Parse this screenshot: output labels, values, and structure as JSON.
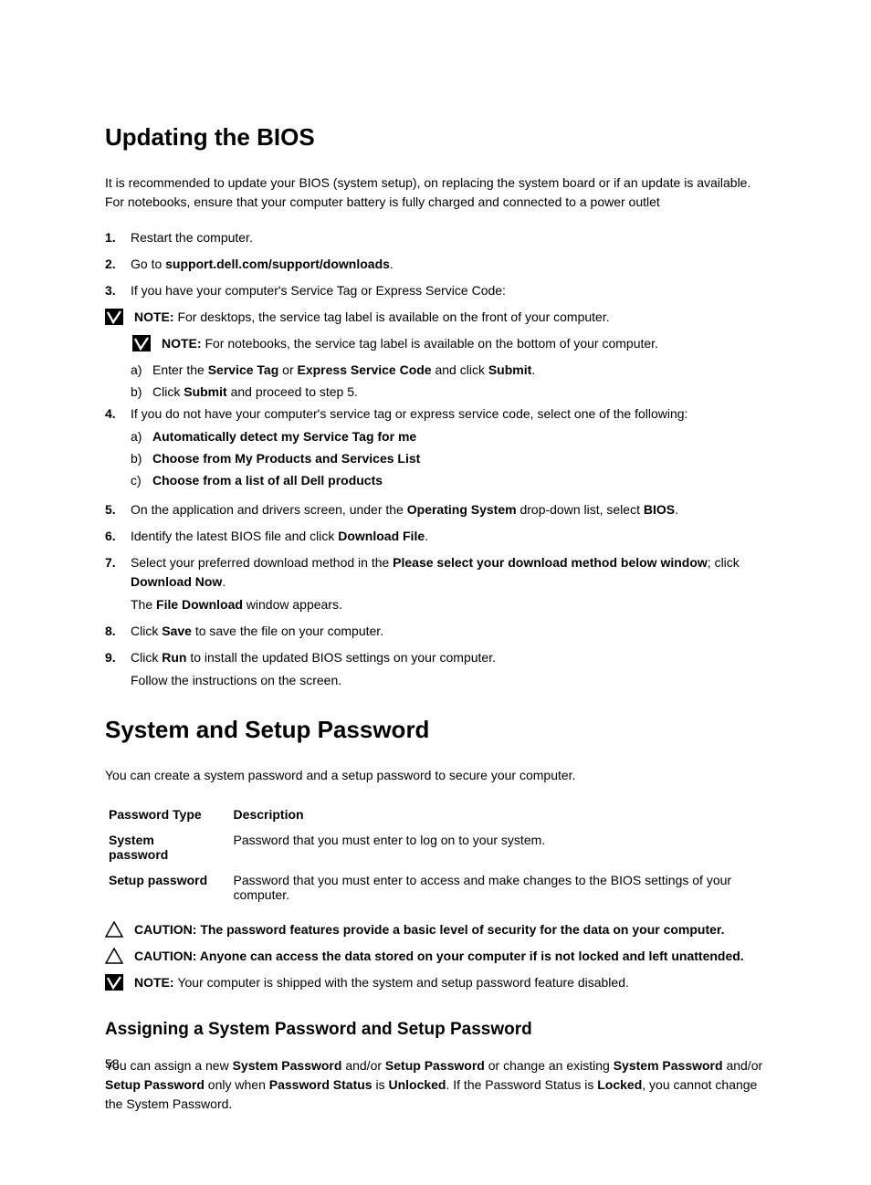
{
  "section1": {
    "title": "Updating the BIOS",
    "intro": "It is recommended to update your BIOS (system setup), on replacing the system board or if an update is available. For notebooks, ensure that your computer battery is fully charged and connected to a power outlet",
    "step1": "Restart the computer.",
    "step2_pre": "Go to ",
    "step2_bold": "support.dell.com/support/downloads",
    "step2_post": ".",
    "step3": "If you have your computer's Service Tag or Express Service Code:",
    "note1_label": "NOTE: ",
    "note1_text": "For desktops, the service tag label is available on the front of your computer.",
    "note2_label": "NOTE: ",
    "note2_text": "For notebooks, the service tag label is available on the bottom of your computer.",
    "step3a_pre": "Enter the ",
    "step3a_b1": "Service Tag",
    "step3a_mid": " or ",
    "step3a_b2": "Express Service Code",
    "step3a_mid2": " and click ",
    "step3a_b3": "Submit",
    "step3a_post": ".",
    "step3b_pre": "Click ",
    "step3b_b1": "Submit",
    "step3b_post": " and proceed to step 5.",
    "step4": "If you do not have your computer's service tag or express service code, select one of the following:",
    "step4a": "Automatically detect my Service Tag for me",
    "step4b": "Choose from My Products and Services List",
    "step4c": "Choose from a list of all Dell products",
    "step5_pre": "On the application and drivers screen, under the ",
    "step5_b1": "Operating System",
    "step5_mid": " drop-down list, select ",
    "step5_b2": "BIOS",
    "step5_post": ".",
    "step6_pre": "Identify the latest BIOS file and click ",
    "step6_b1": "Download File",
    "step6_post": ".",
    "step7_pre": "Select your preferred download method in the ",
    "step7_b1": "Please select your download method below window",
    "step7_mid": "; click ",
    "step7_b2": "Download Now",
    "step7_post": ".",
    "step7_after_pre": "The ",
    "step7_after_b": "File Download",
    "step7_after_post": " window appears.",
    "step8_pre": "Click ",
    "step8_b1": "Save",
    "step8_post": " to save the file on your computer.",
    "step9_pre": "Click ",
    "step9_b1": "Run",
    "step9_post": " to install the updated BIOS settings on your computer.",
    "step9_after": "Follow the instructions on the screen."
  },
  "section2": {
    "title": "System and Setup Password",
    "intro": "You can create a system password and a setup password to secure your computer.",
    "th1": "Password Type",
    "th2": "Description",
    "row1_c1": "System password",
    "row1_c2": "Password that you must enter to log on to your system.",
    "row2_c1": "Setup password",
    "row2_c2": "Password that you must enter to access and make changes to the BIOS settings of your computer.",
    "caution1": "CAUTION: The password features provide a basic level of security for the data on your computer.",
    "caution2": "CAUTION: Anyone can access the data stored on your computer if is not locked and left unattended.",
    "note_label": "NOTE: ",
    "note_text": "Your computer is shipped with the system and setup password feature disabled.",
    "sub_title": "Assigning a System Password and Setup Password",
    "sub_p_1": "You can assign a new ",
    "sub_p_b1": "System Password",
    "sub_p_2": " and/or ",
    "sub_p_b2": "Setup Password",
    "sub_p_3": " or change an existing ",
    "sub_p_b3": "System Password",
    "sub_p_4": " and/or ",
    "sub_p_b4": "Setup Password",
    "sub_p_5": " only when ",
    "sub_p_b5": "Password Status",
    "sub_p_6": " is ",
    "sub_p_b6": "Unlocked",
    "sub_p_7": ". If the Password Status is ",
    "sub_p_b7": "Locked",
    "sub_p_8": ", you cannot change the System Password."
  },
  "pagenum": "58"
}
